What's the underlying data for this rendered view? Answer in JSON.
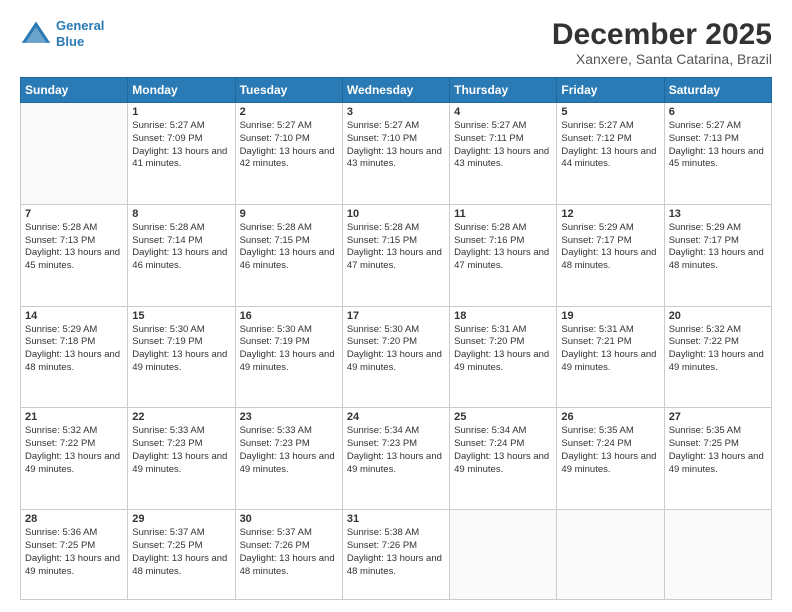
{
  "header": {
    "logo_line1": "General",
    "logo_line2": "Blue",
    "main_title": "December 2025",
    "subtitle": "Xanxere, Santa Catarina, Brazil"
  },
  "days_of_week": [
    "Sunday",
    "Monday",
    "Tuesday",
    "Wednesday",
    "Thursday",
    "Friday",
    "Saturday"
  ],
  "weeks": [
    [
      {
        "day": "",
        "sunrise": "",
        "sunset": "",
        "daylight": ""
      },
      {
        "day": "1",
        "sunrise": "Sunrise: 5:27 AM",
        "sunset": "Sunset: 7:09 PM",
        "daylight": "Daylight: 13 hours and 41 minutes."
      },
      {
        "day": "2",
        "sunrise": "Sunrise: 5:27 AM",
        "sunset": "Sunset: 7:10 PM",
        "daylight": "Daylight: 13 hours and 42 minutes."
      },
      {
        "day": "3",
        "sunrise": "Sunrise: 5:27 AM",
        "sunset": "Sunset: 7:10 PM",
        "daylight": "Daylight: 13 hours and 43 minutes."
      },
      {
        "day": "4",
        "sunrise": "Sunrise: 5:27 AM",
        "sunset": "Sunset: 7:11 PM",
        "daylight": "Daylight: 13 hours and 43 minutes."
      },
      {
        "day": "5",
        "sunrise": "Sunrise: 5:27 AM",
        "sunset": "Sunset: 7:12 PM",
        "daylight": "Daylight: 13 hours and 44 minutes."
      },
      {
        "day": "6",
        "sunrise": "Sunrise: 5:27 AM",
        "sunset": "Sunset: 7:13 PM",
        "daylight": "Daylight: 13 hours and 45 minutes."
      }
    ],
    [
      {
        "day": "7",
        "sunrise": "Sunrise: 5:28 AM",
        "sunset": "Sunset: 7:13 PM",
        "daylight": "Daylight: 13 hours and 45 minutes."
      },
      {
        "day": "8",
        "sunrise": "Sunrise: 5:28 AM",
        "sunset": "Sunset: 7:14 PM",
        "daylight": "Daylight: 13 hours and 46 minutes."
      },
      {
        "day": "9",
        "sunrise": "Sunrise: 5:28 AM",
        "sunset": "Sunset: 7:15 PM",
        "daylight": "Daylight: 13 hours and 46 minutes."
      },
      {
        "day": "10",
        "sunrise": "Sunrise: 5:28 AM",
        "sunset": "Sunset: 7:15 PM",
        "daylight": "Daylight: 13 hours and 47 minutes."
      },
      {
        "day": "11",
        "sunrise": "Sunrise: 5:28 AM",
        "sunset": "Sunset: 7:16 PM",
        "daylight": "Daylight: 13 hours and 47 minutes."
      },
      {
        "day": "12",
        "sunrise": "Sunrise: 5:29 AM",
        "sunset": "Sunset: 7:17 PM",
        "daylight": "Daylight: 13 hours and 48 minutes."
      },
      {
        "day": "13",
        "sunrise": "Sunrise: 5:29 AM",
        "sunset": "Sunset: 7:17 PM",
        "daylight": "Daylight: 13 hours and 48 minutes."
      }
    ],
    [
      {
        "day": "14",
        "sunrise": "Sunrise: 5:29 AM",
        "sunset": "Sunset: 7:18 PM",
        "daylight": "Daylight: 13 hours and 48 minutes."
      },
      {
        "day": "15",
        "sunrise": "Sunrise: 5:30 AM",
        "sunset": "Sunset: 7:19 PM",
        "daylight": "Daylight: 13 hours and 49 minutes."
      },
      {
        "day": "16",
        "sunrise": "Sunrise: 5:30 AM",
        "sunset": "Sunset: 7:19 PM",
        "daylight": "Daylight: 13 hours and 49 minutes."
      },
      {
        "day": "17",
        "sunrise": "Sunrise: 5:30 AM",
        "sunset": "Sunset: 7:20 PM",
        "daylight": "Daylight: 13 hours and 49 minutes."
      },
      {
        "day": "18",
        "sunrise": "Sunrise: 5:31 AM",
        "sunset": "Sunset: 7:20 PM",
        "daylight": "Daylight: 13 hours and 49 minutes."
      },
      {
        "day": "19",
        "sunrise": "Sunrise: 5:31 AM",
        "sunset": "Sunset: 7:21 PM",
        "daylight": "Daylight: 13 hours and 49 minutes."
      },
      {
        "day": "20",
        "sunrise": "Sunrise: 5:32 AM",
        "sunset": "Sunset: 7:22 PM",
        "daylight": "Daylight: 13 hours and 49 minutes."
      }
    ],
    [
      {
        "day": "21",
        "sunrise": "Sunrise: 5:32 AM",
        "sunset": "Sunset: 7:22 PM",
        "daylight": "Daylight: 13 hours and 49 minutes."
      },
      {
        "day": "22",
        "sunrise": "Sunrise: 5:33 AM",
        "sunset": "Sunset: 7:23 PM",
        "daylight": "Daylight: 13 hours and 49 minutes."
      },
      {
        "day": "23",
        "sunrise": "Sunrise: 5:33 AM",
        "sunset": "Sunset: 7:23 PM",
        "daylight": "Daylight: 13 hours and 49 minutes."
      },
      {
        "day": "24",
        "sunrise": "Sunrise: 5:34 AM",
        "sunset": "Sunset: 7:23 PM",
        "daylight": "Daylight: 13 hours and 49 minutes."
      },
      {
        "day": "25",
        "sunrise": "Sunrise: 5:34 AM",
        "sunset": "Sunset: 7:24 PM",
        "daylight": "Daylight: 13 hours and 49 minutes."
      },
      {
        "day": "26",
        "sunrise": "Sunrise: 5:35 AM",
        "sunset": "Sunset: 7:24 PM",
        "daylight": "Daylight: 13 hours and 49 minutes."
      },
      {
        "day": "27",
        "sunrise": "Sunrise: 5:35 AM",
        "sunset": "Sunset: 7:25 PM",
        "daylight": "Daylight: 13 hours and 49 minutes."
      }
    ],
    [
      {
        "day": "28",
        "sunrise": "Sunrise: 5:36 AM",
        "sunset": "Sunset: 7:25 PM",
        "daylight": "Daylight: 13 hours and 49 minutes."
      },
      {
        "day": "29",
        "sunrise": "Sunrise: 5:37 AM",
        "sunset": "Sunset: 7:25 PM",
        "daylight": "Daylight: 13 hours and 48 minutes."
      },
      {
        "day": "30",
        "sunrise": "Sunrise: 5:37 AM",
        "sunset": "Sunset: 7:26 PM",
        "daylight": "Daylight: 13 hours and 48 minutes."
      },
      {
        "day": "31",
        "sunrise": "Sunrise: 5:38 AM",
        "sunset": "Sunset: 7:26 PM",
        "daylight": "Daylight: 13 hours and 48 minutes."
      },
      {
        "day": "",
        "sunrise": "",
        "sunset": "",
        "daylight": ""
      },
      {
        "day": "",
        "sunrise": "",
        "sunset": "",
        "daylight": ""
      },
      {
        "day": "",
        "sunrise": "",
        "sunset": "",
        "daylight": ""
      }
    ]
  ]
}
